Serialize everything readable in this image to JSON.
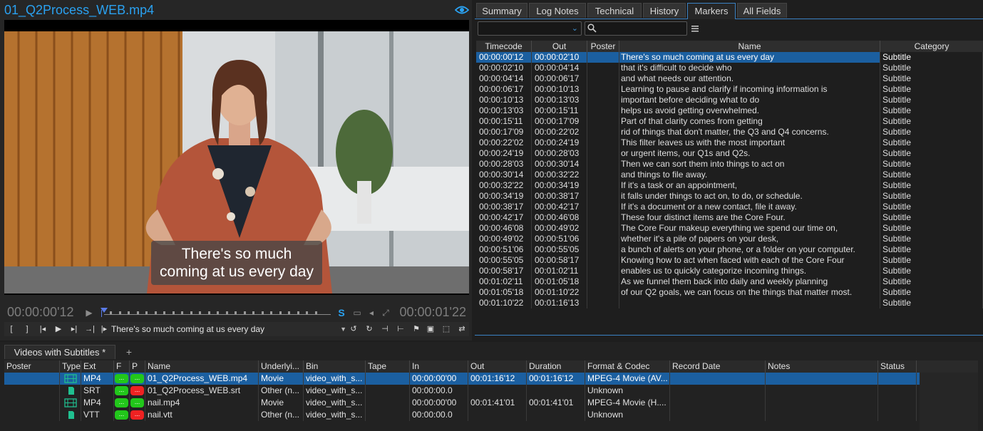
{
  "viewer": {
    "title": "01_Q2Process_WEB.mp4",
    "subtitle_lines": [
      "There's so much",
      "coming at us every day"
    ],
    "current_timecode": "00:00:00'12",
    "duration_timecode": "00:00:01'22",
    "selected_marker_text": "There's so much coming at us every day"
  },
  "tabs": [
    "Summary",
    "Log Notes",
    "Technical",
    "History",
    "Markers",
    "All Fields"
  ],
  "active_tab": "Markers",
  "markers": {
    "columns": [
      "Timecode",
      "Out",
      "Poster",
      "Name",
      "Category"
    ],
    "rows": [
      [
        "00:00:00'12",
        "00:00:02'10",
        "",
        "There's so much coming at us every day",
        "Subtitle"
      ],
      [
        "00:00:02'10",
        "00:00:04'14",
        "",
        "that it's difficult to decide who",
        "Subtitle"
      ],
      [
        "00:00:04'14",
        "00:00:06'17",
        "",
        "and what needs our attention.",
        "Subtitle"
      ],
      [
        "00:00:06'17",
        "00:00:10'13",
        "",
        "Learning to pause and clarify if incoming information is",
        "Subtitle"
      ],
      [
        "00:00:10'13",
        "00:00:13'03",
        "",
        "important before deciding what to do",
        "Subtitle"
      ],
      [
        "00:00:13'03",
        "00:00:15'11",
        "",
        "helps us avoid getting overwhelmed.",
        "Subtitle"
      ],
      [
        "00:00:15'11",
        "00:00:17'09",
        "",
        "Part of that clarity comes from getting",
        "Subtitle"
      ],
      [
        "00:00:17'09",
        "00:00:22'02",
        "",
        "rid of things that don't matter, the Q3 and Q4 concerns.",
        "Subtitle"
      ],
      [
        "00:00:22'02",
        "00:00:24'19",
        "",
        "This filter leaves us with the most important",
        "Subtitle"
      ],
      [
        "00:00:24'19",
        "00:00:28'03",
        "",
        "or urgent items, our Q1s and Q2s.",
        "Subtitle"
      ],
      [
        "00:00:28'03",
        "00:00:30'14",
        "",
        "Then we can sort them into things to act on",
        "Subtitle"
      ],
      [
        "00:00:30'14",
        "00:00:32'22",
        "",
        "and things to file away.",
        "Subtitle"
      ],
      [
        "00:00:32'22",
        "00:00:34'19",
        "",
        "If it's a task or an appointment,",
        "Subtitle"
      ],
      [
        "00:00:34'19",
        "00:00:38'17",
        "",
        "it falls under things to act on, to do, or schedule.",
        "Subtitle"
      ],
      [
        "00:00:38'17",
        "00:00:42'17",
        "",
        "If it's a document or a new contact, file it away.",
        "Subtitle"
      ],
      [
        "00:00:42'17",
        "00:00:46'08",
        "",
        "These four distinct items are the Core Four.",
        "Subtitle"
      ],
      [
        "00:00:46'08",
        "00:00:49'02",
        "",
        "The Core Four makeup everything we spend our time on,",
        "Subtitle"
      ],
      [
        "00:00:49'02",
        "00:00:51'06",
        "",
        "whether it's a pile of papers on your desk,",
        "Subtitle"
      ],
      [
        "00:00:51'06",
        "00:00:55'05",
        "",
        "a bunch of alerts on your phone, or a folder on your computer.",
        "Subtitle"
      ],
      [
        "00:00:55'05",
        "00:00:58'17",
        "",
        "Knowing how to act when faced with each of the Core Four",
        "Subtitle"
      ],
      [
        "00:00:58'17",
        "00:01:02'11",
        "",
        "enables us to quickly categorize incoming things.",
        "Subtitle"
      ],
      [
        "00:01:02'11",
        "00:01:05'18",
        "",
        "As we funnel them back into daily and weekly planning",
        "Subtitle"
      ],
      [
        "00:01:05'18",
        "00:01:10'22",
        "",
        "of our Q2 goals, we can focus on the things that matter most.",
        "Subtitle"
      ],
      [
        "00:01:10'22",
        "00:01:16'13",
        "",
        "",
        "Subtitle"
      ]
    ],
    "selected_row": 0
  },
  "bin": {
    "tab_label": "Videos with Subtitles *",
    "add_tab": "+",
    "columns": [
      "Poster",
      "Type",
      "Ext",
      "F",
      "P",
      "Name",
      "Underlyi...",
      "Bin",
      "Tape",
      "In",
      "Out",
      "Duration",
      "Format & Codec",
      "Record Date",
      "Notes",
      "Status"
    ],
    "rows": [
      {
        "type": "video",
        "ext": "MP4",
        "f": "green",
        "p": "green",
        "name": "01_Q2Process_WEB.mp4",
        "underlying": "Movie",
        "bin": "video_with_s...",
        "tape": "",
        "in": "00:00:00'00",
        "out": "00:01:16'12",
        "duration": "00:01:16'12",
        "format": "MPEG-4 Movie (AV...",
        "record_date": "",
        "notes": "",
        "status": ""
      },
      {
        "type": "doc",
        "ext": "SRT",
        "f": "green",
        "p": "red",
        "name": "01_Q2Process_WEB.srt",
        "underlying": "Other (n...",
        "bin": "video_with_s...",
        "tape": "",
        "in": "00:00:00.0",
        "out": "",
        "duration": "",
        "format": "Unknown",
        "record_date": "",
        "notes": "",
        "status": ""
      },
      {
        "type": "video",
        "ext": "MP4",
        "f": "green",
        "p": "green",
        "name": "nail.mp4",
        "underlying": "Movie",
        "bin": "video_with_s...",
        "tape": "",
        "in": "00:00:00'00",
        "out": "00:01:41'01",
        "duration": "00:01:41'01",
        "format": "MPEG-4 Movie (H....",
        "record_date": "",
        "notes": "",
        "status": ""
      },
      {
        "type": "doc",
        "ext": "VTT",
        "f": "green",
        "p": "red",
        "name": "nail.vtt",
        "underlying": "Other (n...",
        "bin": "video_with_s...",
        "tape": "",
        "in": "00:00:00.0",
        "out": "",
        "duration": "",
        "format": "Unknown",
        "record_date": "",
        "notes": "",
        "status": ""
      }
    ],
    "selected_row": 0,
    "pill_text": "..."
  },
  "colors": {
    "accent": "#2aa1f0",
    "selection": "#1b5fa0",
    "status_green": "#22c71b",
    "status_red": "#ee2222"
  }
}
